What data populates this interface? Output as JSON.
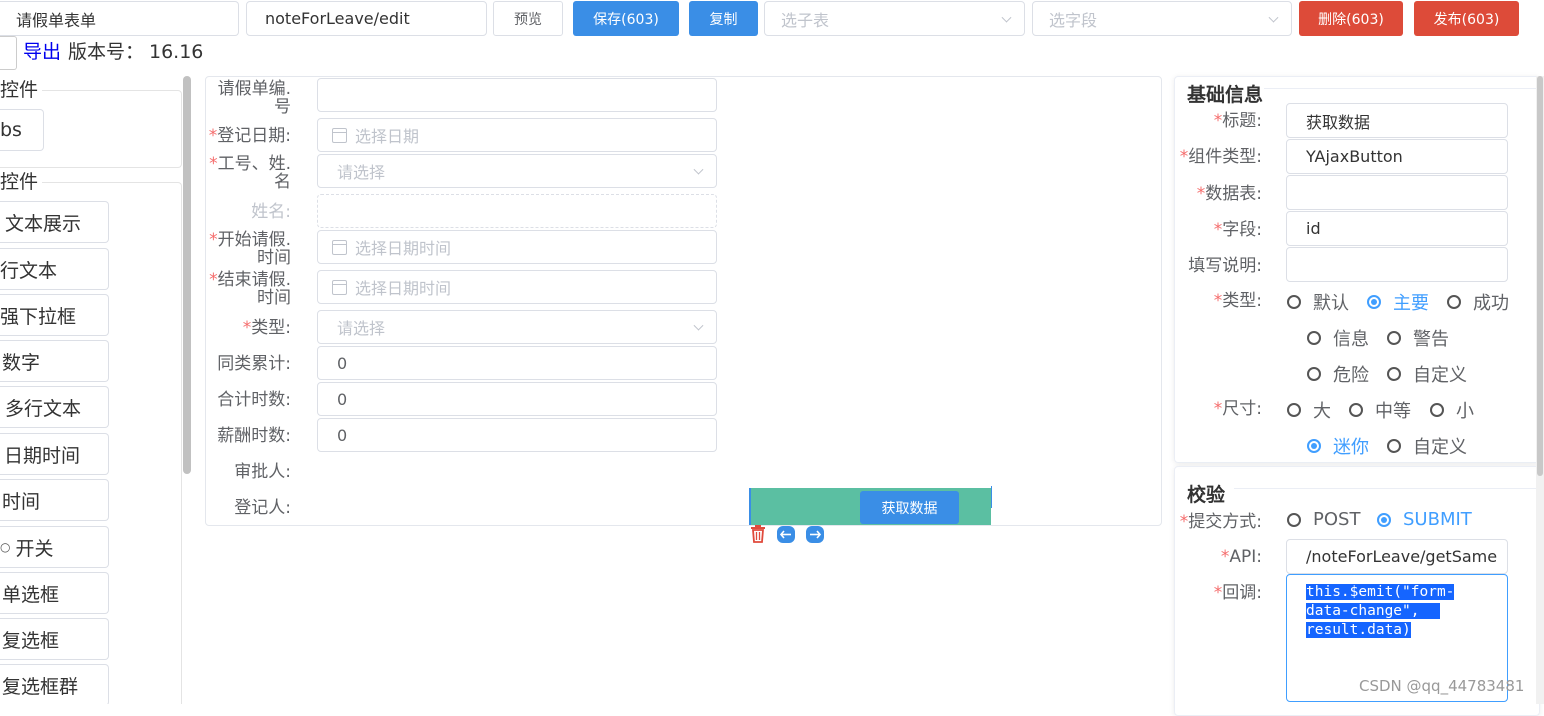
{
  "toolbar": {
    "form_name": "请假单表单",
    "route": "noteForLeave/edit",
    "preview_label": "预览",
    "save_label": "保存(603)",
    "copy_label": "复制",
    "subtable_placeholder": "选子表",
    "field_placeholder": "选字段",
    "delete_label": "删除(603)",
    "publish_label": "发布(603)"
  },
  "subbar": {
    "export_label": "导出",
    "version_label": "版本号：",
    "version_value": "16.16"
  },
  "sidebar": {
    "group1_title": "控件",
    "tabs_item": "bs",
    "group2_title": "控件",
    "items": [
      "文本展示",
      "行文本",
      "强下拉框",
      "数字",
      "多行文本",
      "日期时间",
      "时间",
      "开关",
      "单选框",
      "复选框",
      "复选框群"
    ]
  },
  "form": {
    "fields": [
      {
        "label_line1": "请假单编.",
        "label_line2": "号",
        "required": false,
        "value": "",
        "placeholder": "",
        "kind": "text"
      },
      {
        "label_line1": "登记日期:",
        "label_line2": "",
        "required": true,
        "value": "",
        "placeholder": "选择日期",
        "kind": "date"
      },
      {
        "label_line1": "工号、姓.",
        "label_line2": "名",
        "required": true,
        "value": "",
        "placeholder": "请选择",
        "kind": "select"
      },
      {
        "label_line1": "姓名:",
        "label_line2": "",
        "required": false,
        "value": "",
        "placeholder": "",
        "kind": "disabled"
      },
      {
        "label_line1": "开始请假.",
        "label_line2": "时间",
        "required": true,
        "value": "",
        "placeholder": "选择日期时间",
        "kind": "date"
      },
      {
        "label_line1": "结束请假.",
        "label_line2": "时间",
        "required": true,
        "value": "",
        "placeholder": "选择日期时间",
        "kind": "date"
      },
      {
        "label_line1": "类型:",
        "label_line2": "",
        "required": true,
        "value": "",
        "placeholder": "请选择",
        "kind": "select"
      },
      {
        "label_line1": "同类累计:",
        "label_line2": "",
        "required": false,
        "value": "0",
        "placeholder": "",
        "kind": "text"
      },
      {
        "label_line1": "合计时数:",
        "label_line2": "",
        "required": false,
        "value": "0",
        "placeholder": "",
        "kind": "text"
      },
      {
        "label_line1": "薪酬时数:",
        "label_line2": "",
        "required": false,
        "value": "0",
        "placeholder": "",
        "kind": "text"
      }
    ],
    "approver_label": "审批人:",
    "registrar_label": "登记人:",
    "ajax_button_label": "获取数据"
  },
  "props": {
    "basic_title": "基础信息",
    "title_label": "标题:",
    "title_value": "获取数据",
    "component_label": "组件类型:",
    "component_value": "YAjaxButton",
    "table_label": "数据表:",
    "table_value": "",
    "field_label": "字段:",
    "field_value": "id",
    "desc_label": "填写说明:",
    "desc_value": "",
    "type_label": "类型:",
    "type_options": [
      "默认",
      "主要",
      "成功",
      "信息",
      "警告",
      "危险",
      "自定义"
    ],
    "type_selected": "主要",
    "size_label": "尺寸:",
    "size_options": [
      "大",
      "中等",
      "小",
      "迷你",
      "自定义"
    ],
    "size_selected": "迷你",
    "validate_title": "校验",
    "submit_label": "提交方式:",
    "submit_options": [
      "POST",
      "SUBMIT"
    ],
    "submit_selected": "SUBMIT",
    "api_label": "API:",
    "api_value": "/noteForLeave/getSame",
    "callback_label": "回调:",
    "callback_lines": [
      "this.$emit(\"form-",
      "data-change\",",
      "result.data)"
    ]
  },
  "watermark": "CSDN @qq_44783481",
  "colors": {
    "primary": "#3a8ee6",
    "danger": "#dd4b39",
    "teal": "#5bbfa2",
    "required": "#f56c6c",
    "selection": "#1565ff"
  }
}
